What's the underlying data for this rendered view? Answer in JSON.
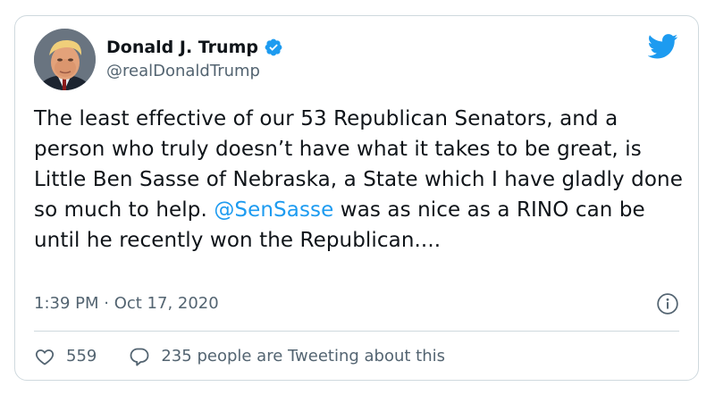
{
  "author": {
    "name": "Donald J. Trump",
    "handle": "@realDonaldTrump",
    "avatar_icon": "avatar-photo",
    "verified_icon": "verified-badge-icon"
  },
  "tweet": {
    "text_part1": "The least effective of our 53 Republican Senators, and a person who truly doesn’t have what it takes to be great, is Little Ben Sasse of Nebraska, a State which I have gladly done so much to help. ",
    "mention": "@SenSasse",
    "text_part2": " was as nice as a RINO can be until he recently won the Republican....",
    "timestamp": "1:39 PM · Oct 17, 2020"
  },
  "actions": {
    "like_count": "559",
    "reply_text": "235 people are Tweeting about this"
  },
  "colors": {
    "accent": "#1d9bf0",
    "text_primary": "#0f1419",
    "text_secondary": "#536471",
    "border": "#cfd9de"
  }
}
